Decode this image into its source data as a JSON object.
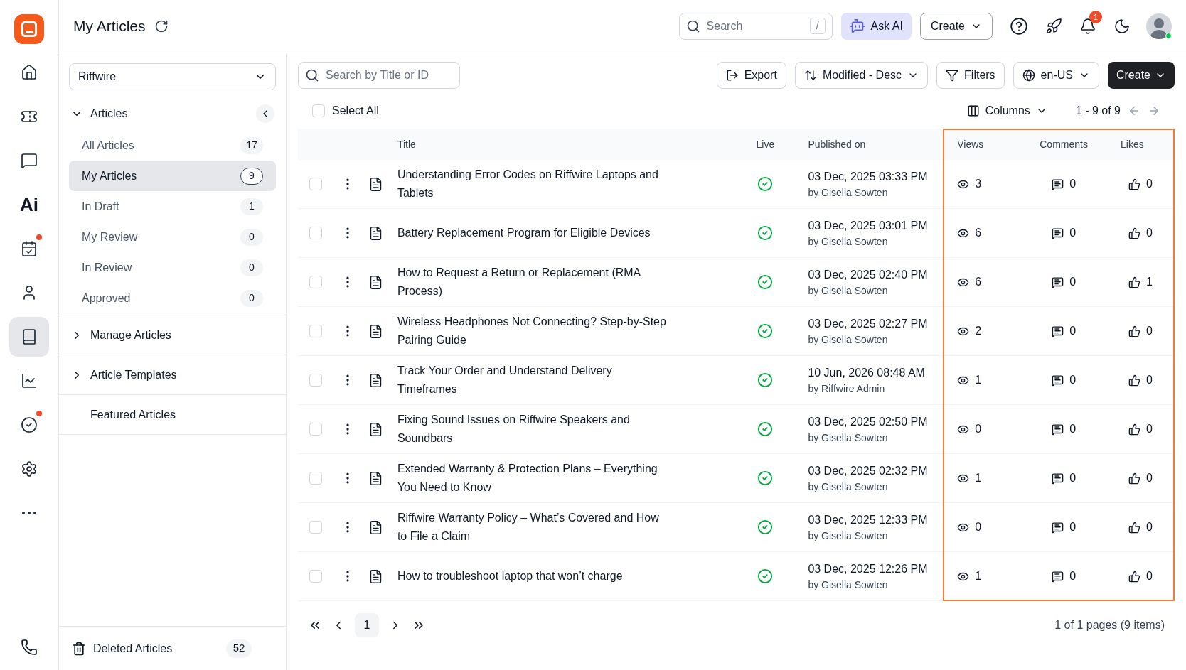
{
  "rail": {
    "items": [
      {
        "kind": "home",
        "selected": false,
        "dot": false
      },
      {
        "kind": "ticket",
        "selected": false,
        "dot": false
      },
      {
        "kind": "chat",
        "selected": false,
        "dot": false
      },
      {
        "kind": "ai",
        "label": "Ai",
        "selected": false,
        "dot": false
      },
      {
        "kind": "calendar",
        "selected": false,
        "dot": true
      },
      {
        "kind": "user",
        "selected": false,
        "dot": false
      },
      {
        "kind": "book",
        "selected": true,
        "dot": false
      },
      {
        "kind": "chart",
        "selected": false,
        "dot": false
      },
      {
        "kind": "check",
        "selected": false,
        "dot": true
      },
      {
        "kind": "settings",
        "selected": false,
        "dot": false
      },
      {
        "kind": "more",
        "selected": false,
        "dot": false
      }
    ],
    "bottom": {
      "kind": "phone"
    }
  },
  "header": {
    "title": "My Articles",
    "search": {
      "placeholder": "Search",
      "shortcut": "/"
    },
    "ask_ai": "Ask AI",
    "create": "Create",
    "notification_count": "1"
  },
  "sidebar": {
    "brand_select": "Riffwire",
    "section": {
      "label": "Articles",
      "expanded": true,
      "items": [
        {
          "label": "All Articles",
          "count": "17",
          "selected": false
        },
        {
          "label": "My Articles",
          "count": "9",
          "selected": true
        },
        {
          "label": "In Draft",
          "count": "1",
          "selected": false
        },
        {
          "label": "My Review",
          "count": "0",
          "selected": false
        },
        {
          "label": "In Review",
          "count": "0",
          "selected": false
        },
        {
          "label": "Approved",
          "count": "0",
          "selected": false
        }
      ]
    },
    "groups": [
      {
        "label": "Manage Articles",
        "kind": "collapsible",
        "expanded": false
      },
      {
        "label": "Article Templates",
        "kind": "collapsible",
        "expanded": false
      },
      {
        "label": "Featured Articles",
        "kind": "link"
      }
    ],
    "deleted": {
      "label": "Deleted Articles",
      "count": "52"
    }
  },
  "toolbar": {
    "search": {
      "placeholder": "Search by Title or ID"
    },
    "export": "Export",
    "sort": "Modified - Desc",
    "filters": "Filters",
    "locale": "en-US",
    "create": "Create"
  },
  "list_bar": {
    "select_all": {
      "label": "Select All",
      "checked": false
    },
    "columns": "Columns",
    "range": "1 - 9 of 9"
  },
  "table": {
    "columns": [
      "Title",
      "Live",
      "Published on",
      "Views",
      "Comments",
      "Likes"
    ],
    "rows": [
      {
        "checked": false,
        "title": "Understanding Error Codes on Riffwire Laptops and Tablets",
        "live": true,
        "published": "03 Dec, 2025 03:33 PM",
        "author": "by Gisella Sowten",
        "views": "3",
        "comments": "0",
        "likes": "0"
      },
      {
        "checked": false,
        "title": "Battery Replacement Program for Eligible Devices",
        "live": true,
        "published": "03 Dec, 2025 03:01 PM",
        "author": "by Gisella Sowten",
        "views": "6",
        "comments": "0",
        "likes": "0"
      },
      {
        "checked": false,
        "title": "How to Request a Return or Replacement (RMA Process)",
        "live": true,
        "published": "03 Dec, 2025 02:40 PM",
        "author": "by Gisella Sowten",
        "views": "6",
        "comments": "0",
        "likes": "1"
      },
      {
        "checked": false,
        "title": "Wireless Headphones Not Connecting? Step-by-Step Pairing Guide",
        "live": true,
        "published": "03 Dec, 2025 02:27 PM",
        "author": "by Gisella Sowten",
        "views": "2",
        "comments": "0",
        "likes": "0"
      },
      {
        "checked": false,
        "title": "Track Your Order and Understand Delivery Timeframes",
        "live": true,
        "published": "10 Jun, 2026 08:48 AM",
        "author": "by Riffwire Admin",
        "views": "1",
        "comments": "0",
        "likes": "0"
      },
      {
        "checked": false,
        "title": "Fixing Sound Issues on Riffwire Speakers and Soundbars",
        "live": true,
        "published": "03 Dec, 2025 02:50 PM",
        "author": "by Gisella Sowten",
        "views": "0",
        "comments": "0",
        "likes": "0"
      },
      {
        "checked": false,
        "title": "Extended Warranty & Protection Plans – Everything You Need to Know",
        "live": true,
        "published": "03 Dec, 2025 02:32 PM",
        "author": "by Gisella Sowten",
        "views": "1",
        "comments": "0",
        "likes": "0"
      },
      {
        "checked": false,
        "title": "Riffwire Warranty Policy – What’s Covered and How to File a Claim",
        "live": true,
        "published": "03 Dec, 2025 12:33 PM",
        "author": "by Gisella Sowten",
        "views": "0",
        "comments": "0",
        "likes": "0"
      },
      {
        "checked": false,
        "title": "How to troubleshoot laptop that won’t charge",
        "live": true,
        "published": "03 Dec, 2025 12:26 PM",
        "author": "by Gisella Sowten",
        "views": "1",
        "comments": "0",
        "likes": "0"
      }
    ]
  },
  "pagination": {
    "current_page": "1",
    "summary": "1 of 1 pages (9 items)"
  }
}
